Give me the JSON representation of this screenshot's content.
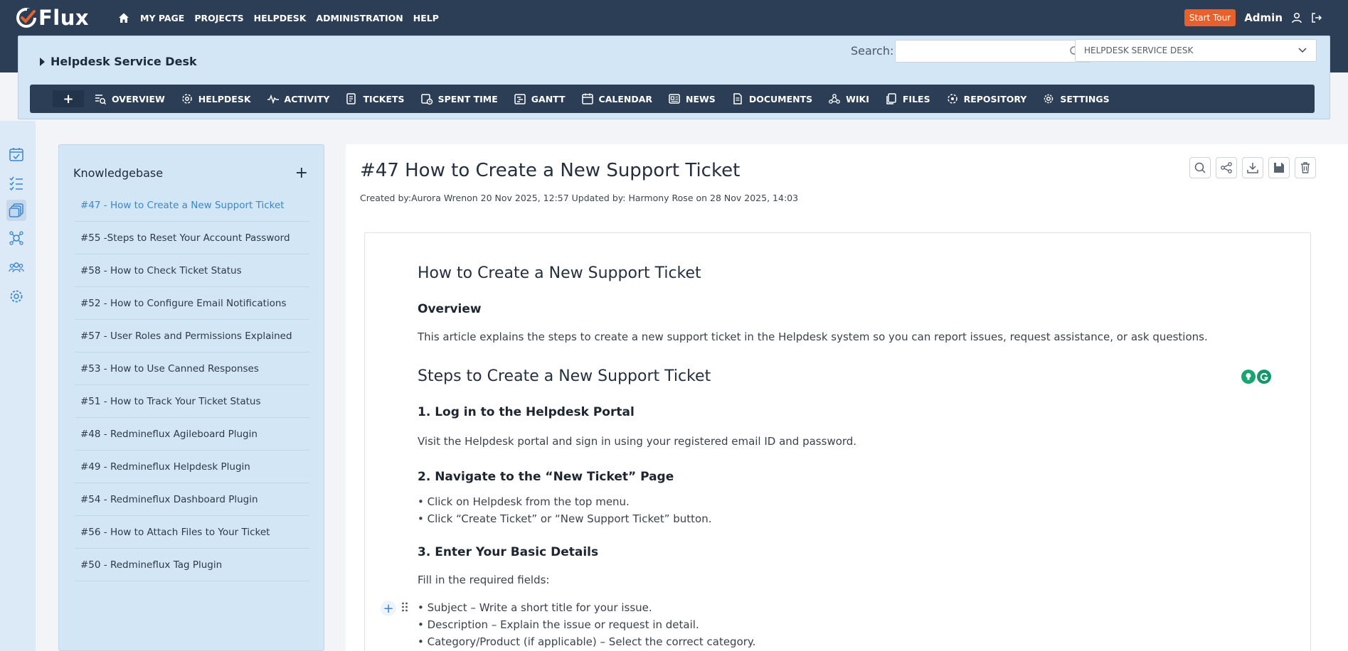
{
  "app": {
    "logo_text": "Flux",
    "brand_color": "#2c3e55",
    "accent_color": "#e8612c",
    "link_color": "#3a86d0"
  },
  "topnav": {
    "items": [
      {
        "label": "MY PAGE"
      },
      {
        "label": "PROJECTS"
      },
      {
        "label": "HELPDESK"
      },
      {
        "label": "ADMINISTRATION"
      },
      {
        "label": "HELP"
      }
    ],
    "start_tour": "Start Tour",
    "user": "Admin"
  },
  "project": {
    "title": "Helpdesk Service Desk",
    "search_label": "Search:",
    "search_value": "",
    "selected_project": "HELPDESK SERVICE DESK"
  },
  "tabs": [
    {
      "label": "OVERVIEW",
      "icon": "overview-icon"
    },
    {
      "label": "HELPDESK",
      "icon": "helpdesk-icon"
    },
    {
      "label": "ACTIVITY",
      "icon": "activity-icon"
    },
    {
      "label": "TICKETS",
      "icon": "tickets-icon"
    },
    {
      "label": "SPENT TIME",
      "icon": "spent-time-icon"
    },
    {
      "label": "GANTT",
      "icon": "gantt-icon"
    },
    {
      "label": "CALENDAR",
      "icon": "calendar-icon"
    },
    {
      "label": "NEWS",
      "icon": "news-icon"
    },
    {
      "label": "DOCUMENTS",
      "icon": "documents-icon"
    },
    {
      "label": "WIKI",
      "icon": "wiki-icon"
    },
    {
      "label": "FILES",
      "icon": "files-icon"
    },
    {
      "label": "REPOSITORY",
      "icon": "repository-icon"
    },
    {
      "label": "SETTINGS",
      "icon": "settings-icon"
    }
  ],
  "rail": [
    "calendar-check-icon",
    "checklist-icon",
    "knowledgebase-icon",
    "network-icon",
    "team-icon",
    "gear-icon"
  ],
  "knowledgebase": {
    "title": "Knowledgebase",
    "add_label": "+",
    "items": [
      {
        "label": "#47 - How to Create a New Support Ticket",
        "active": true
      },
      {
        "label": "#55 -Steps to Reset Your Account Password"
      },
      {
        "label": "#58 - How to Check Ticket Status"
      },
      {
        "label": "#52 - How to Configure Email Notifications"
      },
      {
        "label": "#57 - User Roles and Permissions Explained"
      },
      {
        "label": "#53 - How to Use Canned Responses"
      },
      {
        "label": "#51 - How to Track Your Ticket Status"
      },
      {
        "label": "#48 - Redmineflux Agileboard Plugin"
      },
      {
        "label": "#49 - Redmineflux Helpdesk Plugin"
      },
      {
        "label": "#54 - Redmineflux Dashboard Plugin"
      },
      {
        "label": "#56 - How to Attach Files to Your Ticket"
      },
      {
        "label": "#50 - Redmineflux Tag Plugin"
      }
    ]
  },
  "article": {
    "title": "#47 How to Create a New Support Ticket",
    "meta": "Created by:Aurora Wrenon 20 Nov 2025, 12:57   Updated by: Harmony Rose on 28 Nov 2025, 14:03",
    "content": {
      "h1": "How to Create a New Support Ticket",
      "overview_heading": "Overview",
      "overview_text": "This article explains the steps to create a new support ticket in the Helpdesk system so you can report issues, request assistance, or ask questions.",
      "steps_heading": "Steps to Create a New Support Ticket",
      "step1_heading": "1. Log in to the Helpdesk Portal",
      "step1_text": "Visit the Helpdesk portal and sign in using your registered email ID and password.",
      "step2_heading": "2. Navigate to the “New Ticket” Page",
      "step2_bullet1": "• Click on Helpdesk from the top menu.",
      "step2_bullet2": "• Click “Create Ticket” or “New Support Ticket” button.",
      "step3_heading": "3. Enter Your Basic Details",
      "step3_text": "Fill in the required fields:",
      "step3_bullet1": "• Subject – Write a short title for your issue.",
      "step3_bullet2": "• Description – Explain the issue or request in detail.",
      "step3_bullet3": "• Category/Product (if applicable) – Select the correct category."
    }
  }
}
